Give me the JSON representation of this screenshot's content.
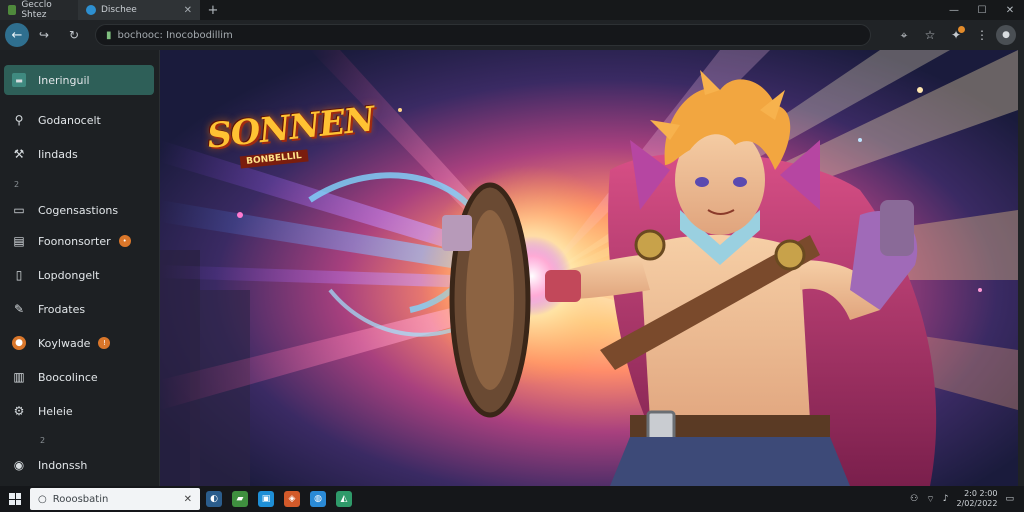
{
  "tabs": [
    {
      "label": "Gecclo Shtez",
      "close": ""
    },
    {
      "label": "Dischee",
      "close": "✕"
    }
  ],
  "window_controls": [
    "—",
    "☐",
    "✕"
  ],
  "toolbar": {
    "back": "←",
    "url": "bochooc: Inocobodillim"
  },
  "sidebar": {
    "items": [
      {
        "label": "Ineringuil",
        "icon": "📁"
      },
      {
        "label": "Godanocelt",
        "icon": "🔍"
      },
      {
        "label": "Iindads",
        "icon": "🔨"
      },
      {
        "label": "Cogensastions",
        "icon": "🖥"
      },
      {
        "label": "Foononsorter",
        "icon": "📄"
      },
      {
        "label": "Lopdongelt",
        "icon": "📋"
      },
      {
        "label": "Frodates",
        "icon": "🔧"
      },
      {
        "label": "Koylwade",
        "icon": "●"
      },
      {
        "label": "Boocolince",
        "icon": "🗑"
      },
      {
        "label": "Heleie",
        "icon": "⚙"
      },
      {
        "label": "Indonssh",
        "icon": "◉"
      }
    ],
    "sections": [
      "2",
      "2"
    ]
  },
  "hero": {
    "logo_title": "SONNEN",
    "logo_sub": "BONBELLIL"
  },
  "taskbar": {
    "search_text": "Rooosbatin",
    "clock_time": "2:0 2:00",
    "clock_date": "2/02/2022"
  },
  "colors": {
    "active_sidebar": "#2e5f58",
    "back_button": "#2f6f8f",
    "badge": "#d9762a"
  }
}
